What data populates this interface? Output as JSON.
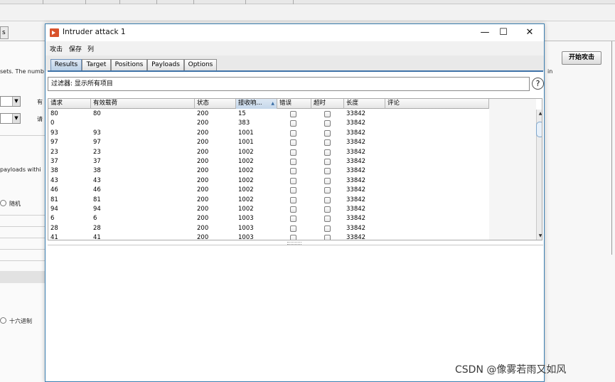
{
  "background": {
    "left_tab_label": "s",
    "text_sets": "sets. The numb",
    "text_in": "in",
    "start_button": "开始攻击",
    "label_you": "有",
    "label_pay": "请",
    "text_payloads_within": "payloads withi",
    "radio_random": "随机",
    "radio_hex": "十六进制"
  },
  "window": {
    "title": "Intruder attack 1",
    "controls": {
      "minimize": "—",
      "maximize": "☐",
      "close": "✕"
    },
    "menu": [
      "攻击",
      "保存",
      "列"
    ],
    "tabs": [
      "Results",
      "Target",
      "Positions",
      "Payloads",
      "Options"
    ],
    "active_tab": "Results",
    "filter_text": "过滤器:  显示所有项目",
    "help_label": "?"
  },
  "table": {
    "columns": [
      "请求",
      "有效载荷",
      "状态",
      "接收响...",
      "错误",
      "超时",
      "长度",
      "评论"
    ],
    "sort_column": "接收响...",
    "sort_indicator": "▲",
    "rows": [
      {
        "request": "80",
        "payload": "80",
        "status": "200",
        "received": "15",
        "length": "33842"
      },
      {
        "request": "0",
        "payload": "",
        "status": "200",
        "received": "383",
        "length": "33842"
      },
      {
        "request": "93",
        "payload": "93",
        "status": "200",
        "received": "1001",
        "length": "33842"
      },
      {
        "request": "97",
        "payload": "97",
        "status": "200",
        "received": "1001",
        "length": "33842"
      },
      {
        "request": "23",
        "payload": "23",
        "status": "200",
        "received": "1002",
        "length": "33842"
      },
      {
        "request": "37",
        "payload": "37",
        "status": "200",
        "received": "1002",
        "length": "33842"
      },
      {
        "request": "38",
        "payload": "38",
        "status": "200",
        "received": "1002",
        "length": "33842"
      },
      {
        "request": "43",
        "payload": "43",
        "status": "200",
        "received": "1002",
        "length": "33842"
      },
      {
        "request": "46",
        "payload": "46",
        "status": "200",
        "received": "1002",
        "length": "33842"
      },
      {
        "request": "81",
        "payload": "81",
        "status": "200",
        "received": "1002",
        "length": "33842"
      },
      {
        "request": "94",
        "payload": "94",
        "status": "200",
        "received": "1002",
        "length": "33842"
      },
      {
        "request": "6",
        "payload": "6",
        "status": "200",
        "received": "1003",
        "length": "33842"
      },
      {
        "request": "28",
        "payload": "28",
        "status": "200",
        "received": "1003",
        "length": "33842"
      },
      {
        "request": "41",
        "payload": "41",
        "status": "200",
        "received": "1003",
        "length": "33842"
      }
    ],
    "scroll_up": "▲",
    "scroll_down": "▼"
  },
  "watermark": "CSDN @像雾若雨又如风",
  "colors": {
    "window_border": "#3c7fb1",
    "active_tab": "#b8cfe6",
    "tab_underline": "#3f73a8"
  }
}
